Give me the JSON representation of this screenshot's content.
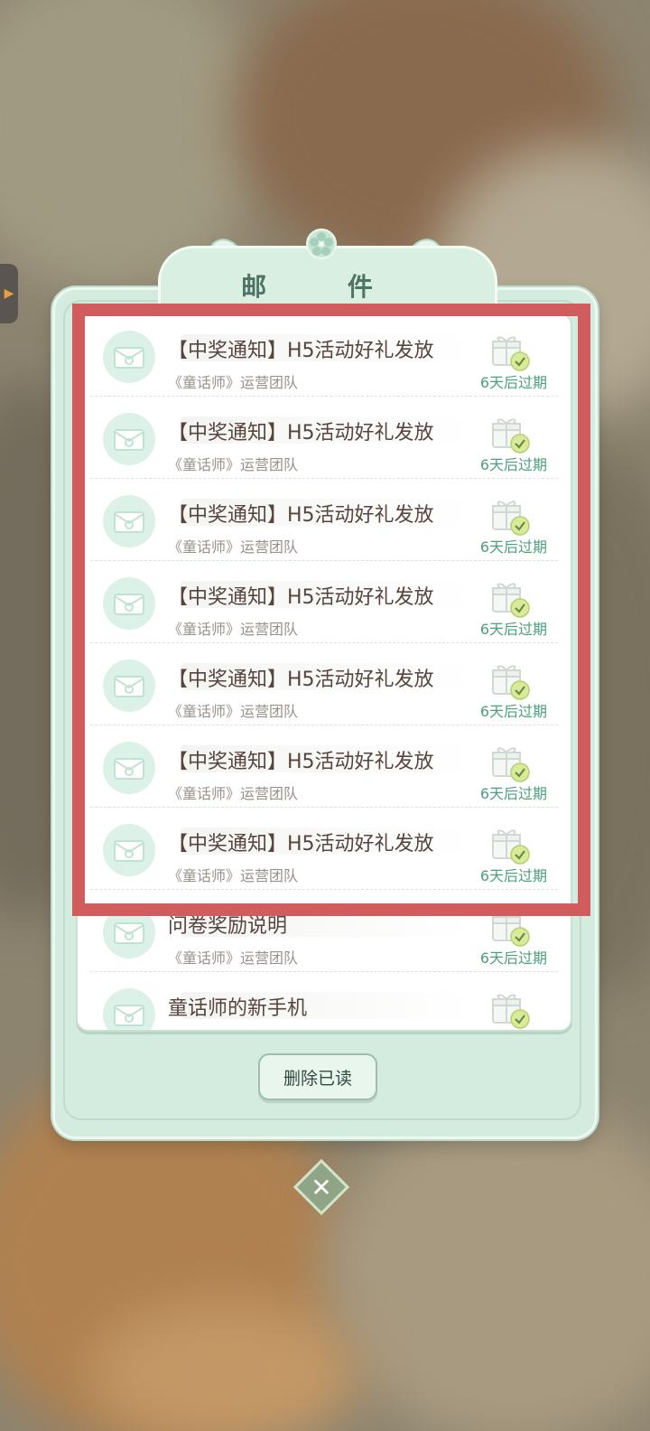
{
  "window": {
    "title": "邮 件"
  },
  "mails": [
    {
      "title": "【中奖通知】H5活动好礼发放",
      "sender": "《童话师》运营团队",
      "expire": "6天后过期"
    },
    {
      "title": "【中奖通知】H5活动好礼发放",
      "sender": "《童话师》运营团队",
      "expire": "6天后过期"
    },
    {
      "title": "【中奖通知】H5活动好礼发放",
      "sender": "《童话师》运营团队",
      "expire": "6天后过期"
    },
    {
      "title": "【中奖通知】H5活动好礼发放",
      "sender": "《童话师》运营团队",
      "expire": "6天后过期"
    },
    {
      "title": "【中奖通知】H5活动好礼发放",
      "sender": "《童话师》运营团队",
      "expire": "6天后过期"
    },
    {
      "title": "【中奖通知】H5活动好礼发放",
      "sender": "《童话师》运营团队",
      "expire": "6天后过期"
    },
    {
      "title": "【中奖通知】H5活动好礼发放",
      "sender": "《童话师》运营团队",
      "expire": "6天后过期"
    },
    {
      "title": "问卷奖励说明",
      "sender": "《童话师》运营团队",
      "expire": "6天后过期"
    },
    {
      "title": "童话师的新手机",
      "sender": "",
      "expire": ""
    }
  ],
  "buttons": {
    "delete_read": "删除已读",
    "close": "✕"
  },
  "colors": {
    "panel": "#d4ebdf",
    "expire_text": "#4aa07b",
    "highlight": "#d05c5d"
  }
}
